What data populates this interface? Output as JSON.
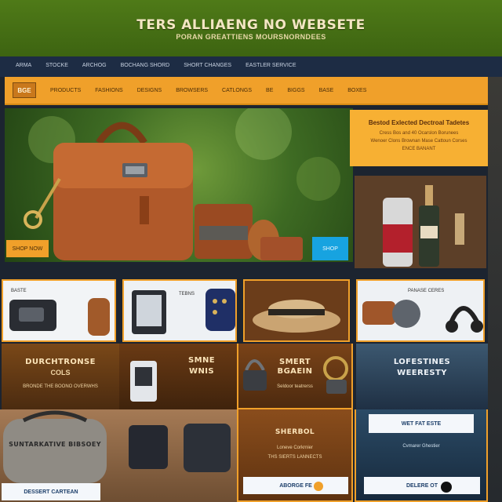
{
  "banner": {
    "title": "TERS ALLIAENG NO WEBSETE",
    "subtitle": "PORAN GREATTIENS MOURSNORNDEES"
  },
  "top_nav": {
    "items": [
      "ARMA",
      "STOCKE",
      "ARCHOG",
      "BOCHANG SHORD",
      "SHORT CHANGES",
      "EASTLER SERVICE"
    ]
  },
  "main_nav": {
    "logo": "BGE",
    "items": [
      "PRODUCTS",
      "FASHIONS",
      "DESIGNS",
      "BROWSERS",
      "CATLONGS",
      "BE",
      "BIGGS",
      "BASE",
      "BOXES"
    ]
  },
  "hero": {
    "shop_button": "SHOP NOW",
    "blue_button": "SHOP"
  },
  "info_panel": {
    "title": "Bestod Exlected Dectroal Tadetes",
    "lines": [
      "Cress Bos and 40 Ocarslon Borunees",
      "Wenoer Clons Brownan Mase Cattoun Corses",
      "ENCE BANANT"
    ]
  },
  "product_cards": [
    {
      "label": "BASTE"
    },
    {
      "label": "TEBNS"
    },
    {
      "label": ""
    },
    {
      "label": "PANASE CERES"
    }
  ],
  "promo_tiles": [
    {
      "title": "DURCHTRONSE",
      "subtitle": "COLS",
      "line": "BRONDE THE BOONO OVERWHS"
    },
    {
      "title": "SMNE",
      "subtitle": "WNIS",
      "line": ""
    },
    {
      "title": "SMERT",
      "subtitle": "BGAEIN",
      "line": "Seldoor teatrerss"
    },
    {
      "title": "LOFESTINES",
      "subtitle": "WEERESTY",
      "line": ""
    }
  ],
  "bottom_sections": {
    "left_banner": "SUNTARKATIVE BIBSOEY",
    "left_button": "DESSERT CARTEAN",
    "middle_title": "SHERBOL",
    "middle_lines": [
      "Loneve Corkrnier",
      "THS SIERTS LANNECTS"
    ],
    "middle_button": "ABORGE FE",
    "right_box": "WET FAT ESTE",
    "right_lines": [
      "Cvmarer Ghestier"
    ],
    "right_button": "DELERE OT"
  }
}
